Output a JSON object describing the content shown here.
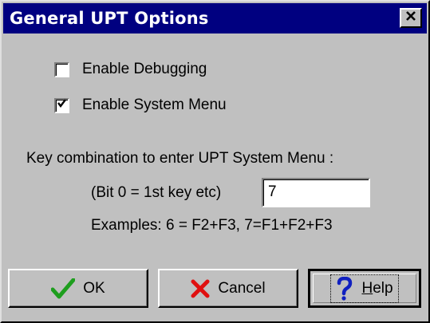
{
  "window": {
    "title": "General UPT Options"
  },
  "icons": {
    "close": "close-icon",
    "ok": "checkmark-icon",
    "cancel": "x-icon",
    "help": "question-mark-icon"
  },
  "options": {
    "debugging": {
      "label": "Enable Debugging",
      "checked": false
    },
    "system_menu": {
      "label": "Enable System Menu",
      "checked": true
    }
  },
  "keycombo": {
    "heading": "Key combination to enter UPT System Menu  :",
    "hint": "(Bit 0 = 1st key etc)",
    "value": "7",
    "examples": "Examples: 6 = F2+F3,  7=F1+F2+F3"
  },
  "buttons": {
    "ok": "OK",
    "cancel": "Cancel",
    "help": "Help"
  },
  "colors": {
    "titlebar": "#000080",
    "face": "#c0c0c0",
    "ok_icon": "#1e9e1e",
    "cancel_icon": "#e01010",
    "help_icon": "#1020c0"
  }
}
